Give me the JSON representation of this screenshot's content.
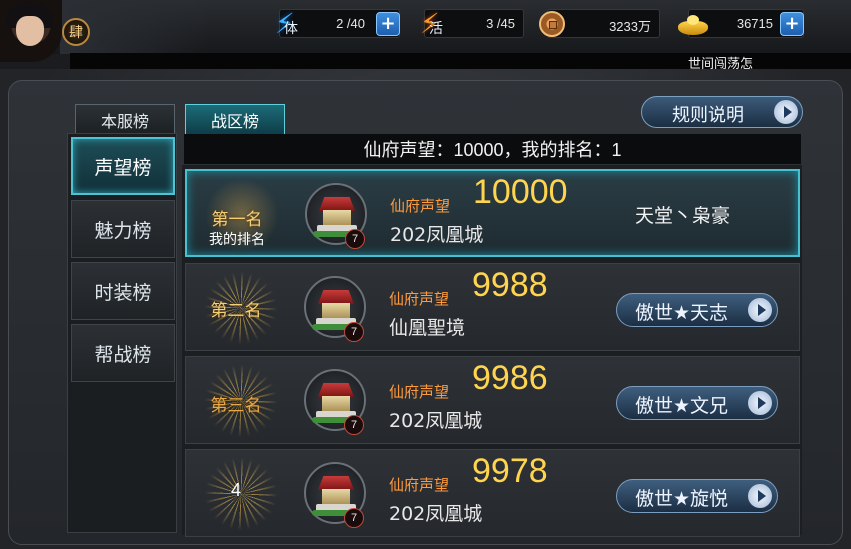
{
  "player": {
    "level_badge": "肆"
  },
  "resources": {
    "stamina": {
      "icon_label": "体",
      "value": "2 /40"
    },
    "vitality": {
      "icon_label": "活",
      "value": "3 /45"
    },
    "copper": {
      "value": "3233万"
    },
    "gold": {
      "value": "36715"
    }
  },
  "marquee": {
    "text": "世间闯荡怎"
  },
  "tabs": [
    {
      "label": "本服榜",
      "active": false
    },
    {
      "label": "战区榜",
      "active": true
    }
  ],
  "rules_button": {
    "label": "规则说明"
  },
  "sidebar": {
    "items": [
      {
        "label": "声望榜",
        "active": true
      },
      {
        "label": "魅力榜",
        "active": false
      },
      {
        "label": "时装榜",
        "active": false
      },
      {
        "label": "帮战榜",
        "active": false
      }
    ]
  },
  "summary": {
    "text": "仙府声望：10000，我的排名：1"
  },
  "ranking": {
    "rows": [
      {
        "rank_label": "第一名",
        "rank_sub": "我的排名",
        "palace_level": "7",
        "metric_label": "仙府声望",
        "metric_value": "10000",
        "server": "202凤凰城",
        "player": "天堂丶枭豪",
        "is_me": true
      },
      {
        "rank_label": "第二名",
        "palace_level": "7",
        "metric_label": "仙府声望",
        "metric_value": "9988",
        "server": "仙凰聖境",
        "player": "傲世★天志",
        "is_me": false
      },
      {
        "rank_label": "第三名",
        "palace_level": "7",
        "metric_label": "仙府声望",
        "metric_value": "9986",
        "server": "202凤凰城",
        "player": "傲世★文兄",
        "is_me": false
      },
      {
        "rank_label": "4",
        "palace_level": "7",
        "metric_label": "仙府声望",
        "metric_value": "9978",
        "server": "202凤凰城",
        "player": "傲世★旋悦",
        "is_me": false
      }
    ]
  },
  "colors": {
    "accent_cyan": "#4fc3d2",
    "metric_label": "#ff9a3c",
    "metric_value": "#ffd54f",
    "rank_gold": "#f5cf78"
  }
}
